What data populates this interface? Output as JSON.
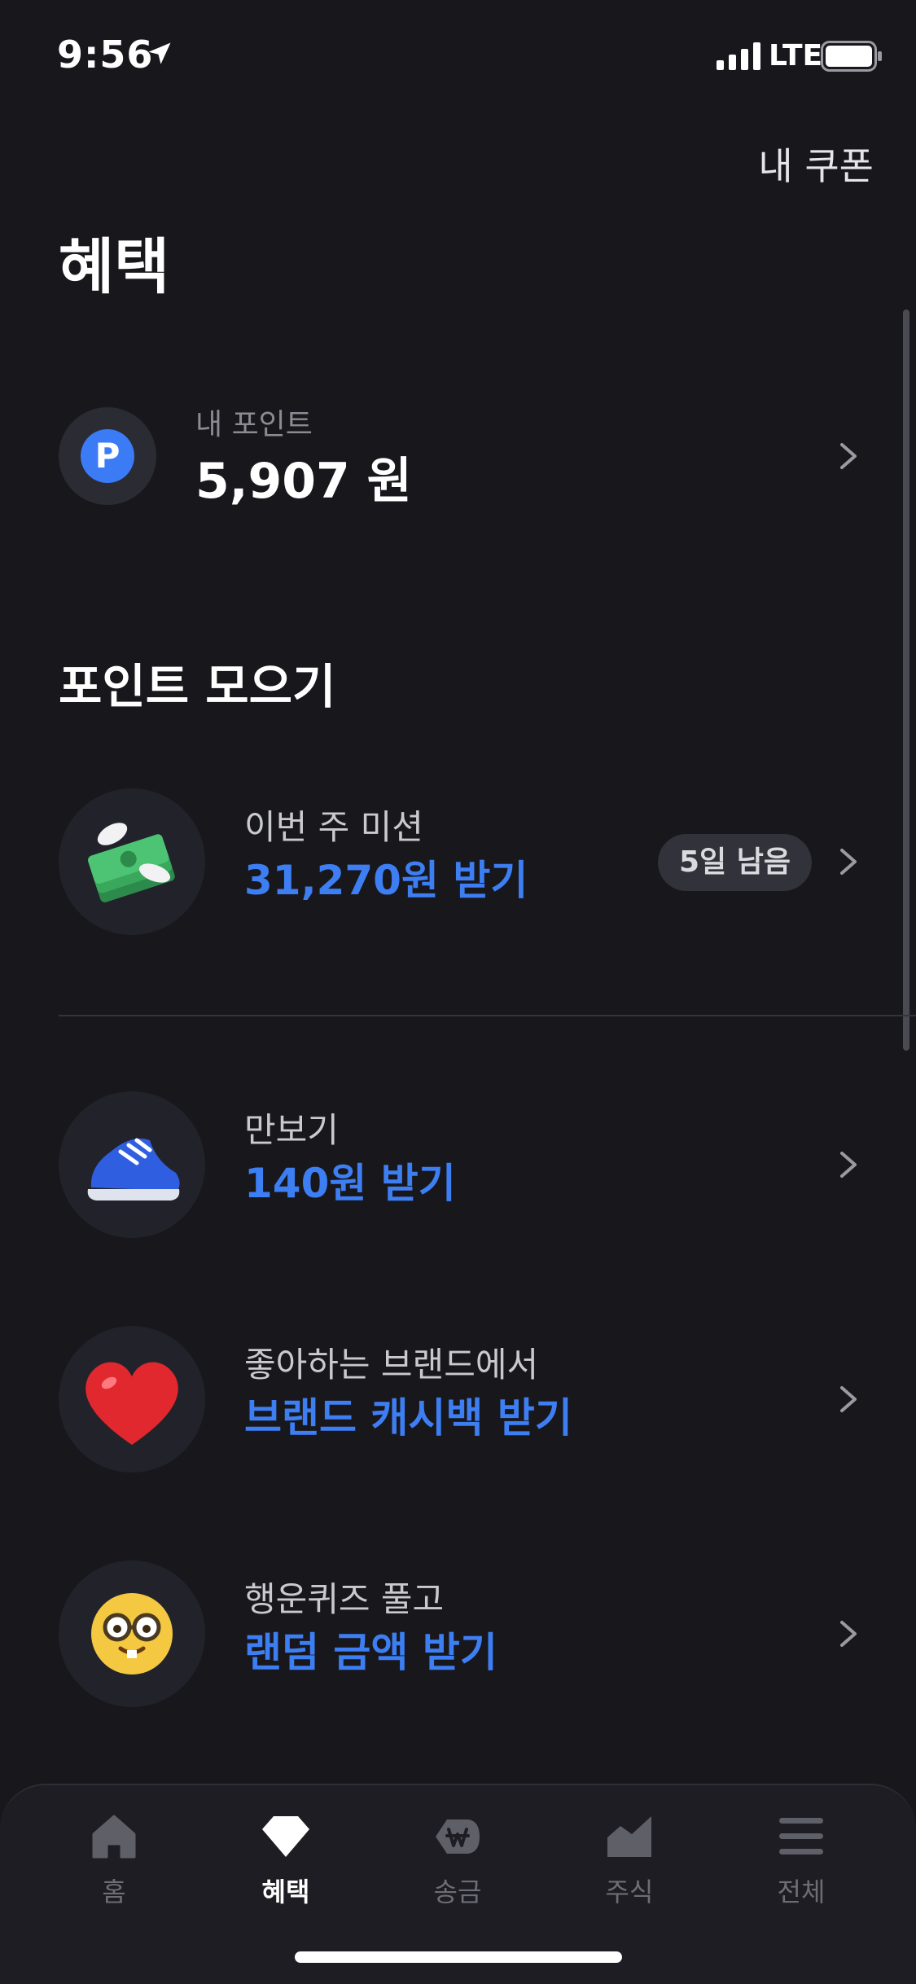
{
  "status_bar": {
    "time": "9:56",
    "network": "LTE"
  },
  "header": {
    "coupon_link": "내 쿠폰",
    "title": "혜택"
  },
  "points": {
    "badge": "P",
    "label": "내 포인트",
    "value": "5,907 원"
  },
  "section_title": "포인트 모으기",
  "items": [
    {
      "icon": "flying-money-icon",
      "subtitle": "이번 주 미션",
      "title": "31,270원 받기",
      "badge": "5일 남음"
    },
    {
      "icon": "sneaker-icon",
      "subtitle": "만보기",
      "title": "140원 받기"
    },
    {
      "icon": "heart-icon",
      "subtitle": "좋아하는 브랜드에서",
      "title": "브랜드 캐시백 받기"
    },
    {
      "icon": "nerd-face-icon",
      "subtitle": "행운퀴즈 풀고",
      "title": "랜덤 금액 받기"
    }
  ],
  "tab_bar": {
    "tabs": [
      {
        "label": "홈",
        "icon": "home-icon"
      },
      {
        "label": "혜택",
        "icon": "gem-icon",
        "active": true
      },
      {
        "label": "송금",
        "icon": "won-icon"
      },
      {
        "label": "주식",
        "icon": "chart-icon"
      },
      {
        "label": "전체",
        "icon": "menu-icon"
      }
    ]
  },
  "colors": {
    "background": "#18171c",
    "accent": "#3d7ef3",
    "point_badge": "#3b7bf5",
    "muted": "#8b8b94"
  }
}
